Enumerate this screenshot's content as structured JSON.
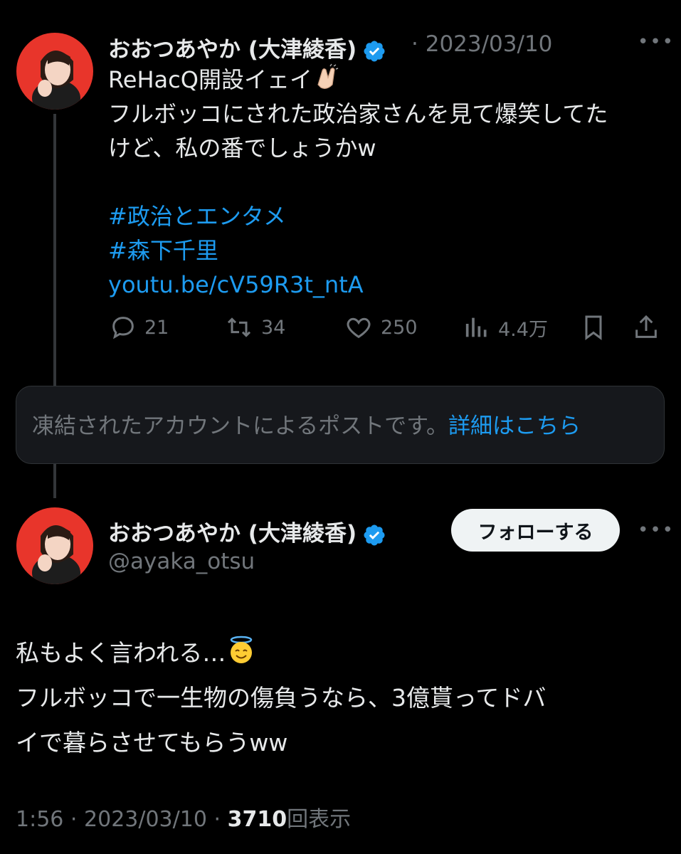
{
  "quoted_post": {
    "author_name": "おおつあやか (大津綾香)",
    "separator": "·",
    "date": "2023/03/10",
    "text_line1": "ReHacQ開設イェイ",
    "emoji1": "clapping-hands",
    "text_line2": "フルボッコにされた政治家さんを見て爆笑してた",
    "text_line3": "けど、私の番でしょうかw",
    "hashtag1": "#政治とエンタメ",
    "hashtag2": "#森下千里",
    "url": "youtu.be/cV59R3t_ntA",
    "actions": {
      "replies": "21",
      "reposts": "34",
      "likes": "250",
      "views": "4.4万"
    }
  },
  "notice": {
    "text": "凍結されたアカウントによるポストです。",
    "link": "詳細はこちら"
  },
  "main_post": {
    "author_name": "おおつあやか (大津綾香)",
    "handle": "@ayaka_otsu",
    "follow_label": "フォローする",
    "text_line1": "私もよく言われる…",
    "emoji2": "smiling-face-with-halo",
    "text_line2": "フルボッコで一生物の傷負うなら、3億貰ってドバ",
    "text_line3": "イで暮らさせてもらうww",
    "footer": {
      "time": "1:56",
      "sep1": "·",
      "date": "2023/03/10",
      "sep2": "·",
      "views_count": "3710",
      "views_label": "回表示"
    }
  },
  "colors": {
    "background": "#000000",
    "text": "#e7e9ea",
    "muted": "#71767b",
    "link": "#1d9bf0",
    "verified": "#1d9bf0"
  }
}
